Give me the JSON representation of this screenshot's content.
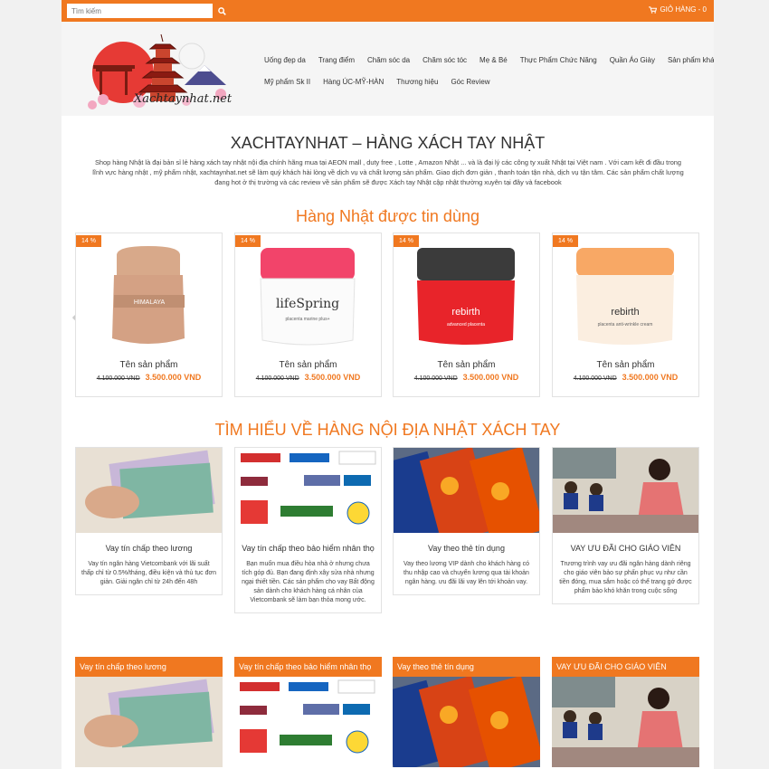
{
  "topbar": {
    "search_placeholder": "Tìm kiếm",
    "cart_label": "GIỎ HÀNG - 0"
  },
  "logo": {
    "text": "Xachtaynhat.net"
  },
  "nav": {
    "row1": [
      "Uống đẹp da",
      "Trang điểm",
      "Chăm sóc da",
      "Chăm sóc tóc",
      "Mẹ & Bé",
      "Thực Phẩm Chức Năng",
      "Quần Áo Giày",
      "Sản phẩm khác"
    ],
    "row2": [
      "Mỹ phẩm Sk II",
      "Hàng ÚC-MỸ-HÀN",
      "Thương hiệu",
      "Góc Review"
    ]
  },
  "page": {
    "title": "XACHTAYNHAT – HÀNG XÁCH TAY NHẬT",
    "intro": "Shop hàng Nhật là đại bản sỉ lẻ hàng xách tay nhật nội địa chính hãng mua tại AEON mall , duty free , Lotte , Amazon Nhật ... và là đại lý các công ty xuất Nhật tại Việt nam . Với cam kết đi đầu trong lĩnh vực hàng nhật , mỹ phẩm nhật, xachtaynhat.net sẽ làm quý khách hài lòng về dịch vụ và chất lượng sản phẩm. Giao dịch đơn giản , thanh toán tận nhà, dịch vụ tận tâm. Các sản phẩm chất lượng đang hot ở thị trường và các review về sản phẩm sẽ được Xách tay Nhật cập nhật thường xuyên tại đây và facebook",
    "section1": "Hàng Nhật được tin dùng",
    "section2": "TÌM HIỂU VỀ HÀNG NỘI ĐỊA NHẬT XÁCH TAY"
  },
  "products": [
    {
      "badge": "14 %",
      "name": "Tên sản phẩm",
      "old_price": "4.100.000 VND",
      "price": "3.500.000 VND",
      "label": "HIMALAYA"
    },
    {
      "badge": "14 %",
      "name": "Tên sản phẩm",
      "old_price": "4.100.000 VND",
      "price": "3.500.000 VND",
      "label": "lifeSpring"
    },
    {
      "badge": "14 %",
      "name": "Tên sản phẩm",
      "old_price": "4.100.000 VND",
      "price": "3.500.000 VND",
      "label": "rebirth"
    },
    {
      "badge": "14 %",
      "name": "Tên sản phẩm",
      "old_price": "4.100.000 VND",
      "price": "3.500.000 VND",
      "label": "rebirth"
    }
  ],
  "articles": [
    {
      "title": "Vay tín chấp theo lương",
      "desc": "Vay tín ngân hàng Vietcombank với lãi suất thấp chỉ từ 0.5%/tháng, điều kiện và thủ tục đơn giản. Giải ngân chỉ từ 24h đến 48h"
    },
    {
      "title": "Vay tín chấp theo bảo hiểm nhân thọ",
      "desc": "Bạn muốn mua điều hòa nhà ở nhưng chưa tích góp đủ. Bạn đang định xây sửa nhà nhưng ngại thiết tiền. Các sản phẩm cho vay Bất động sản dành cho khách hàng cá nhân của Vietcombank sẽ làm bạn thỏa mong ước."
    },
    {
      "title": "Vay theo thẻ tín dụng",
      "desc": "Vay theo lương VIP dành cho khách hàng có thu nhập cao và chuyển lương qua tài khoản ngân hàng. ưu đãi lãi vay lên tới khoản vay."
    },
    {
      "title": "VAY ƯU ĐÃI CHO GIÁO VIÊN",
      "desc": "Trương trình vay ưu đãi ngân hàng dành riêng cho giáo viên bảo sự phấn phục vụ như cần tiền đóng, mua sắm hoặc có thể trang gớ được phẩm bảo khó khăn trong cuộc sống"
    }
  ],
  "tiles": [
    {
      "title": "Vay tín chấp theo lương"
    },
    {
      "title": "Vay tín chấp theo bảo hiểm nhân thọ"
    },
    {
      "title": "Vay theo thẻ tín dụng"
    },
    {
      "title": "VAY ƯU ĐÃI CHO GIÁO VIÊN"
    }
  ],
  "colors": {
    "accent": "#f07820"
  }
}
